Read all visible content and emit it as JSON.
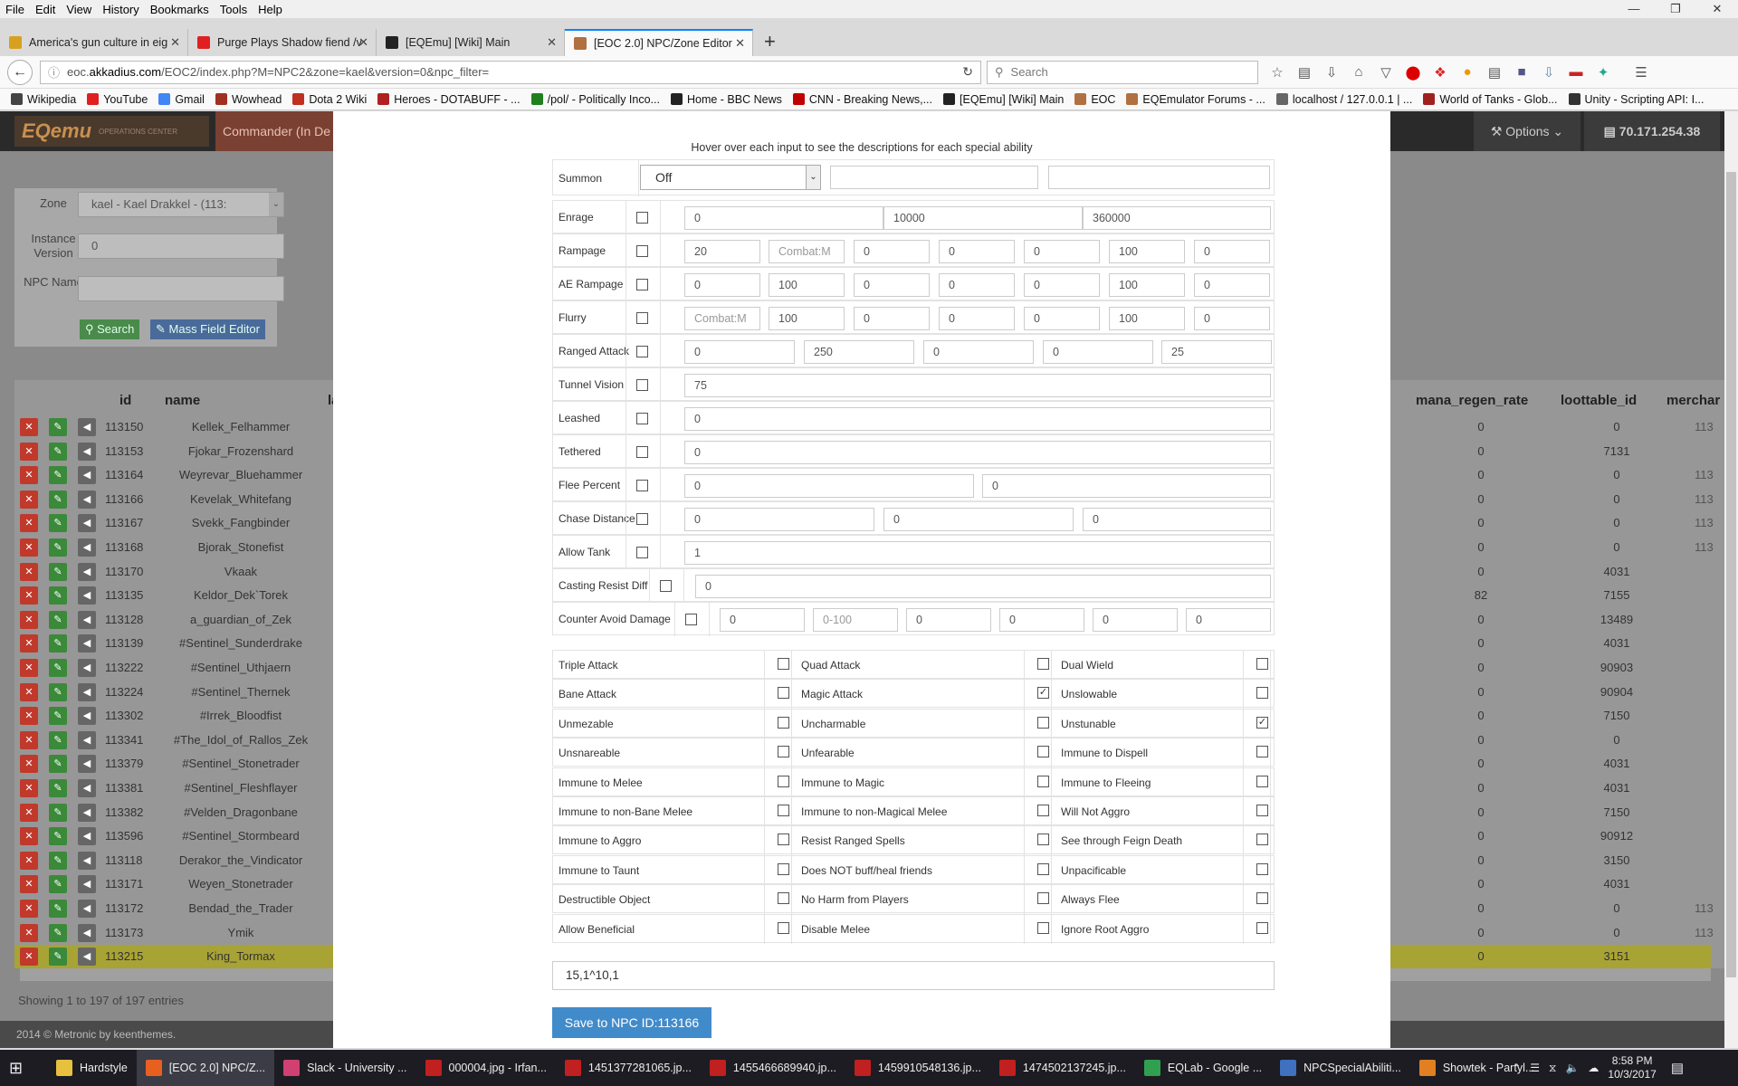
{
  "browser": {
    "menu": [
      "File",
      "Edit",
      "View",
      "History",
      "Bookmarks",
      "Tools",
      "Help"
    ],
    "tabs": [
      {
        "title": "America's gun culture in eig",
        "color": "#d8a020"
      },
      {
        "title": "Purge Plays Shadow fiend /v",
        "color": "#e02020"
      },
      {
        "title": "[EQEmu] [Wiki] Main",
        "color": "#222222"
      },
      {
        "title": "[EOC 2.0] NPC/Zone Editor",
        "color": "#b07040"
      }
    ],
    "url_prefix": "eoc.",
    "url_domain": "akkadius.com",
    "url_rest": "/EOC2/index.php?M=NPC2&zone=kael&version=0&npc_filter=",
    "search_placeholder": "Search",
    "bookmarks": [
      {
        "label": "Wikipedia",
        "color": "#444444"
      },
      {
        "label": "YouTube",
        "color": "#e02020"
      },
      {
        "label": "Gmail",
        "color": "#4285f4"
      },
      {
        "label": "Wowhead",
        "color": "#a03020"
      },
      {
        "label": "Dota 2 Wiki",
        "color": "#c03020"
      },
      {
        "label": "Heroes - DOTABUFF - ...",
        "color": "#b02020"
      },
      {
        "label": "/pol/ - Politically Inco...",
        "color": "#208020"
      },
      {
        "label": "Home - BBC News",
        "color": "#222222"
      },
      {
        "label": "CNN - Breaking News,...",
        "color": "#c00000"
      },
      {
        "label": "[EQEmu] [Wiki] Main",
        "color": "#222222"
      },
      {
        "label": "EOC",
        "color": "#b07040"
      },
      {
        "label": "EQEmulator Forums - ...",
        "color": "#b07040"
      },
      {
        "label": "localhost / 127.0.0.1 | ...",
        "color": "#666666"
      },
      {
        "label": "World of Tanks - Glob...",
        "color": "#a02020"
      },
      {
        "label": "Unity - Scripting API: I...",
        "color": "#333333"
      }
    ]
  },
  "app": {
    "logo": "EQemu",
    "logo_sub": "OPERATIONS CENTER",
    "header_tab": "Commander (In De",
    "options": "Options",
    "ip": "70.171.254.38",
    "zone_label": "Zone",
    "zone_value": "kael - Kael Drakkel - (113:",
    "instance_label": "Instance Version",
    "instance_value": "0",
    "npcname_label": "NPC Name",
    "npcname_value": "",
    "search_btn": "Search",
    "mass_btn": "Mass Field Editor",
    "columns": {
      "id": "id",
      "name": "name",
      "la": "la",
      "mana": "mana_regen_rate",
      "loot": "loottable_id",
      "merch": "merchar"
    },
    "rows": [
      {
        "id": "113150",
        "name": "Kellek_Felhammer",
        "mana": "0",
        "loot": "0",
        "merch": "113"
      },
      {
        "id": "113153",
        "name": "Fjokar_Frozenshard",
        "mana": "0",
        "loot": "7131",
        "merch": ""
      },
      {
        "id": "113164",
        "name": "Weyrevar_Bluehammer",
        "mana": "0",
        "loot": "0",
        "merch": "113"
      },
      {
        "id": "113166",
        "name": "Kevelak_Whitefang",
        "mana": "0",
        "loot": "0",
        "merch": "113"
      },
      {
        "id": "113167",
        "name": "Svekk_Fangbinder",
        "mana": "0",
        "loot": "0",
        "merch": "113"
      },
      {
        "id": "113168",
        "name": "Bjorak_Stonefist",
        "mana": "0",
        "loot": "0",
        "merch": "113"
      },
      {
        "id": "113170",
        "name": "Vkaak",
        "mana": "0",
        "loot": "4031",
        "merch": ""
      },
      {
        "id": "113135",
        "name": "Keldor_Dek`Torek",
        "mana": "82",
        "loot": "7155",
        "merch": ""
      },
      {
        "id": "113128",
        "name": "a_guardian_of_Zek",
        "mana": "0",
        "loot": "13489",
        "merch": ""
      },
      {
        "id": "113139",
        "name": "#Sentinel_Sunderdrake",
        "mana": "0",
        "loot": "4031",
        "merch": ""
      },
      {
        "id": "113222",
        "name": "#Sentinel_Uthjaern",
        "mana": "0",
        "loot": "90903",
        "merch": ""
      },
      {
        "id": "113224",
        "name": "#Sentinel_Thernek",
        "mana": "0",
        "loot": "90904",
        "merch": ""
      },
      {
        "id": "113302",
        "name": "#Irrek_Bloodfist",
        "mana": "0",
        "loot": "7150",
        "merch": ""
      },
      {
        "id": "113341",
        "name": "#The_Idol_of_Rallos_Zek",
        "mana": "0",
        "loot": "0",
        "merch": ""
      },
      {
        "id": "113379",
        "name": "#Sentinel_Stonetrader",
        "mana": "0",
        "loot": "4031",
        "merch": ""
      },
      {
        "id": "113381",
        "name": "#Sentinel_Fleshflayer",
        "mana": "0",
        "loot": "4031",
        "merch": ""
      },
      {
        "id": "113382",
        "name": "#Velden_Dragonbane",
        "mana": "0",
        "loot": "7150",
        "merch": ""
      },
      {
        "id": "113596",
        "name": "#Sentinel_Stormbeard",
        "mana": "0",
        "loot": "90912",
        "merch": ""
      },
      {
        "id": "113118",
        "name": "Derakor_the_Vindicator",
        "mana": "0",
        "loot": "3150",
        "merch": ""
      },
      {
        "id": "113171",
        "name": "Weyen_Stonetrader",
        "mana": "0",
        "loot": "4031",
        "merch": ""
      },
      {
        "id": "113172",
        "name": "Bendad_the_Trader",
        "mana": "0",
        "loot": "0",
        "merch": "113"
      },
      {
        "id": "113173",
        "name": "Ymik",
        "mana": "0",
        "loot": "0",
        "merch": "113"
      },
      {
        "id": "113215",
        "name": "King_Tormax",
        "mana": "0",
        "loot": "3151",
        "merch": ""
      }
    ],
    "showing": "Showing 1 to 197 of 197 entries",
    "footer": "2014 © Metronic by keenthemes."
  },
  "modal": {
    "hint": "Hover over each input to see the descriptions for each special ability",
    "summon": {
      "label": "Summon",
      "select": "Off",
      "v1": "",
      "v2": ""
    },
    "enrage": {
      "label": "Enrage",
      "v": [
        "0",
        "10000",
        "360000"
      ]
    },
    "rampage": {
      "label": "Rampage",
      "v": [
        "20",
        "Combat:M",
        "0",
        "0",
        "0",
        "100",
        "0"
      ]
    },
    "aerampage": {
      "label": "AE Rampage",
      "v": [
        "0",
        "100",
        "0",
        "0",
        "0",
        "100",
        "0"
      ]
    },
    "flurry": {
      "label": "Flurry",
      "v": [
        "Combat:M",
        "100",
        "0",
        "0",
        "0",
        "100",
        "0"
      ]
    },
    "ranged": {
      "label": "Ranged Attack",
      "v": [
        "0",
        "250",
        "0",
        "0",
        "25"
      ]
    },
    "tunnel": {
      "label": "Tunnel Vision",
      "v": [
        "75"
      ]
    },
    "leashed": {
      "label": "Leashed",
      "v": [
        "0"
      ]
    },
    "tethered": {
      "label": "Tethered",
      "v": [
        "0"
      ]
    },
    "flee": {
      "label": "Flee Percent",
      "v": [
        "0",
        "0"
      ]
    },
    "chase": {
      "label": "Chase Distance",
      "v": [
        "0",
        "0",
        "0"
      ]
    },
    "allowtank": {
      "label": "Allow Tank",
      "v": [
        "1"
      ]
    },
    "castresist": {
      "label": "Casting Resist Diff",
      "v": [
        "0"
      ]
    },
    "counteravoid": {
      "label": "Counter Avoid Damage",
      "v": [
        "0",
        "0-100",
        "0",
        "0",
        "0",
        "0"
      ]
    },
    "flags": [
      [
        {
          "l": "Triple Attack",
          "c": false
        },
        {
          "l": "Quad Attack",
          "c": false
        },
        {
          "l": "Dual Wield",
          "c": false
        }
      ],
      [
        {
          "l": "Bane Attack",
          "c": false
        },
        {
          "l": "Magic Attack",
          "c": true
        },
        {
          "l": "Unslowable",
          "c": false
        }
      ],
      [
        {
          "l": "Unmezable",
          "c": false
        },
        {
          "l": "Uncharmable",
          "c": false
        },
        {
          "l": "Unstunable",
          "c": true
        }
      ],
      [
        {
          "l": "Unsnareable",
          "c": false
        },
        {
          "l": "Unfearable",
          "c": false
        },
        {
          "l": "Immune to Dispell",
          "c": false
        }
      ],
      [
        {
          "l": "Immune to Melee",
          "c": false
        },
        {
          "l": "Immune to Magic",
          "c": false
        },
        {
          "l": "Immune to Fleeing",
          "c": false
        }
      ],
      [
        {
          "l": "Immune to non-Bane Melee",
          "c": false
        },
        {
          "l": "Immune to non-Magical Melee",
          "c": false
        },
        {
          "l": "Will Not Aggro",
          "c": false
        }
      ],
      [
        {
          "l": "Immune to Aggro",
          "c": false
        },
        {
          "l": "Resist Ranged Spells",
          "c": false
        },
        {
          "l": "See through Feign Death",
          "c": false
        }
      ],
      [
        {
          "l": "Immune to Taunt",
          "c": false
        },
        {
          "l": "Does NOT buff/heal friends",
          "c": false
        },
        {
          "l": "Unpacificable",
          "c": false
        }
      ],
      [
        {
          "l": "Destructible Object",
          "c": false
        },
        {
          "l": "No Harm from Players",
          "c": false
        },
        {
          "l": "Always Flee",
          "c": false
        }
      ],
      [
        {
          "l": "Allow Beneficial",
          "c": false
        },
        {
          "l": "Disable Melee",
          "c": false
        },
        {
          "l": "Ignore Root Aggro",
          "c": false
        }
      ]
    ],
    "result": "15,1^10,1",
    "save": "Save to NPC ID:113166"
  },
  "taskbar": {
    "items": [
      {
        "label": "Hardstyle",
        "color": "#e8c040"
      },
      {
        "label": "[EOC 2.0] NPC/Z...",
        "color": "#e86020"
      },
      {
        "label": "Slack - University ...",
        "color": "#d04070"
      },
      {
        "label": "000004.jpg - Irfan...",
        "color": "#c02020"
      },
      {
        "label": "1451377281065.jp...",
        "color": "#c02020"
      },
      {
        "label": "1455466689940.jp...",
        "color": "#c02020"
      },
      {
        "label": "1459910548136.jp...",
        "color": "#c02020"
      },
      {
        "label": "1474502137245.jp...",
        "color": "#c02020"
      },
      {
        "label": "EQLab - Google ...",
        "color": "#30a050"
      },
      {
        "label": "NPCSpecialAbiliti...",
        "color": "#4070c0"
      },
      {
        "label": "Showtek - Partyl...",
        "color": "#e08020"
      }
    ],
    "time": "8:58 PM",
    "date": "10/3/2017"
  }
}
